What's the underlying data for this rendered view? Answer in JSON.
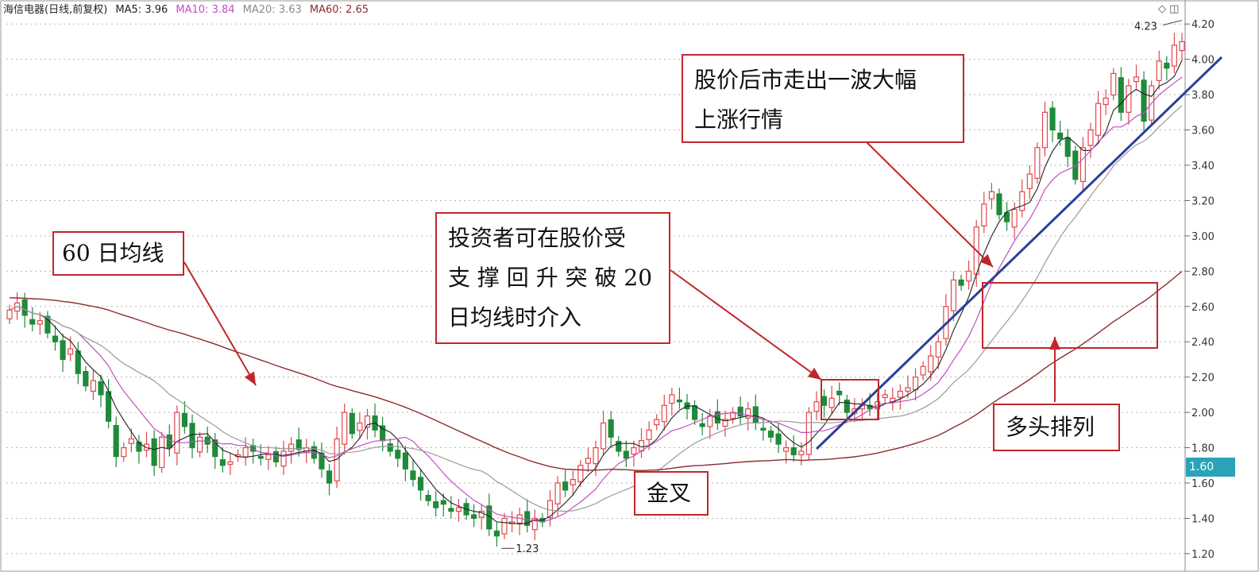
{
  "header": {
    "title": "海信电器(日线,前复权)",
    "ma5": "MA5: 3.96",
    "ma10": "MA10: 3.84",
    "ma20": "MA20: 3.63",
    "ma60": "MA60: 2.65"
  },
  "colors": {
    "up": "#e0474c",
    "down": "#1e8a3a",
    "ma5": "#222222",
    "ma10": "#c24fc0",
    "ma20": "#9a9a9a",
    "ma60": "#8b2d2d",
    "trendline": "#2a3f9a",
    "annotation": "#c0272d",
    "current_price_tag": "#2aa3b8"
  },
  "callouts": {
    "ma60_label": "60 日均线",
    "entry_line1": "投资者可在股价受",
    "entry_line2": "支 撑 回 升 突 破 20",
    "entry_line3": "日均线时介入",
    "rally_line1": "股价后市走出一波大幅",
    "rally_line2": "上涨行情",
    "golden_cross": "金叉",
    "bullish": "多头排列"
  },
  "current_price": "1.60",
  "low_label": "1.23",
  "high_label": "4.23",
  "window_icons": [
    "diamond-icon",
    "restore-icon"
  ],
  "chart_data": {
    "type": "candlestick",
    "title": "海信电器(日线,前复权)",
    "ylim": [
      1.15,
      4.3
    ],
    "y_ticks": [
      "1.20",
      "1.40",
      "1.60",
      "1.80",
      "2.00",
      "2.20",
      "2.40",
      "2.60",
      "2.80",
      "3.00",
      "3.20",
      "3.40",
      "3.60",
      "3.80",
      "4.00",
      "4.20"
    ],
    "closes": [
      2.58,
      2.62,
      2.55,
      2.5,
      2.52,
      2.45,
      2.4,
      2.3,
      2.36,
      2.22,
      2.15,
      2.18,
      2.1,
      1.95,
      1.75,
      1.8,
      1.85,
      1.78,
      1.82,
      1.7,
      1.86,
      1.8,
      2.0,
      1.92,
      1.8,
      1.86,
      1.82,
      1.75,
      1.7,
      1.72,
      1.76,
      1.8,
      1.78,
      1.74,
      1.76,
      1.72,
      1.78,
      1.82,
      1.79,
      1.8,
      1.74,
      1.68,
      1.6,
      1.85,
      2.0,
      1.88,
      1.94,
      1.98,
      1.9,
      1.84,
      1.78,
      1.74,
      1.68,
      1.62,
      1.56,
      1.5,
      1.46,
      1.48,
      1.44,
      1.46,
      1.42,
      1.4,
      1.44,
      1.34,
      1.3,
      1.4,
      1.38,
      1.42,
      1.36,
      1.4,
      1.38,
      1.5,
      1.6,
      1.56,
      1.62,
      1.7,
      1.74,
      1.8,
      1.94,
      1.86,
      1.78,
      1.74,
      1.8,
      1.84,
      1.9,
      1.96,
      2.04,
      2.1,
      2.06,
      2.02,
      1.96,
      1.92,
      1.98,
      1.94,
      1.96,
      2.0,
      1.98,
      2.02,
      1.94,
      1.9,
      1.86,
      1.82,
      1.8,
      1.76,
      1.78,
      2.0,
      2.06,
      2.04,
      2.08,
      2.1,
      2.0,
      2.02,
      2.04,
      2.02,
      2.06,
      2.1,
      2.08,
      2.12,
      2.14,
      2.2,
      2.26,
      2.32,
      2.4,
      2.6,
      2.75,
      2.72,
      2.8,
      3.05,
      3.18,
      3.25,
      3.12,
      3.08,
      3.15,
      3.25,
      3.35,
      3.5,
      3.7,
      3.6,
      3.55,
      3.45,
      3.32,
      3.5,
      3.6,
      3.75,
      3.78,
      3.92,
      3.7,
      3.85,
      3.9,
      3.65,
      3.85,
      3.99,
      3.95,
      4.08,
      4.1
    ],
    "series": [
      {
        "name": "MA5",
        "values": [
          3.96
        ]
      },
      {
        "name": "MA10",
        "values": [
          3.84
        ]
      },
      {
        "name": "MA20",
        "values": [
          3.63
        ]
      },
      {
        "name": "MA60",
        "values": [
          2.65
        ]
      }
    ],
    "annotations": [
      {
        "text": "1.23",
        "type": "low"
      },
      {
        "text": "4.23",
        "type": "high"
      }
    ],
    "grid": true,
    "axis_position": "right"
  }
}
